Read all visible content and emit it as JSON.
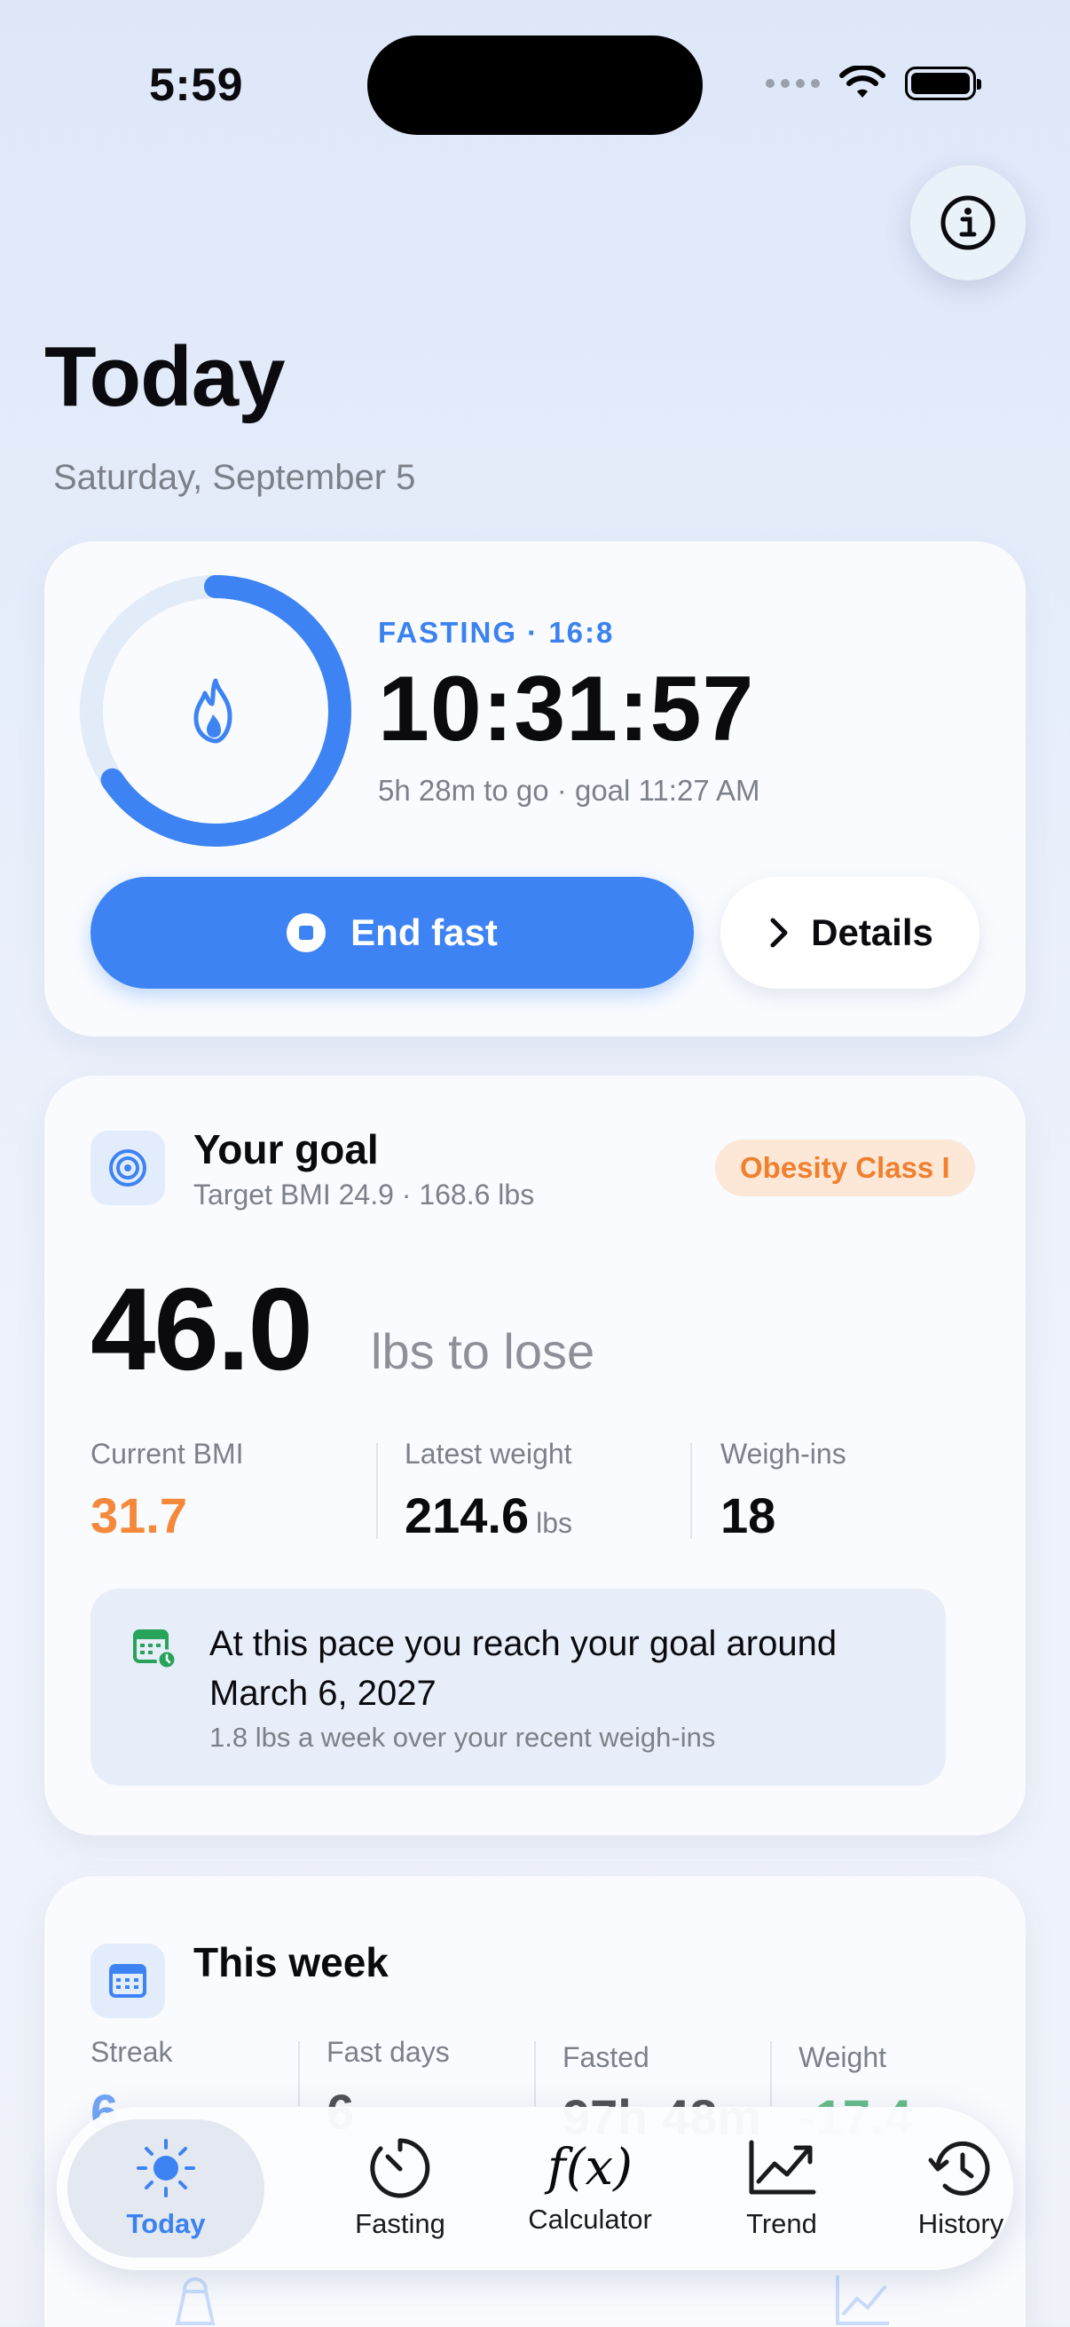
{
  "status_bar": {
    "time": "5:59"
  },
  "header": {
    "title": "Today",
    "date": "Saturday, September 5"
  },
  "fasting_card": {
    "label": "FASTING · 16:8",
    "timer": "10:31:57",
    "subtitle": "5h 28m to go · goal 11:27 AM",
    "progress": 0.656,
    "end_button": "End fast",
    "details_button": "Details",
    "accent": "#3d83f3"
  },
  "goal_card": {
    "title": "Your goal",
    "subtitle": "Target BMI 24.9 · 168.6 lbs",
    "badge": "Obesity Class I",
    "big_value": "46.0",
    "big_unit": "lbs to lose",
    "stats": [
      {
        "label": "Current BMI",
        "value": "31.7",
        "unit": ""
      },
      {
        "label": "Latest weight",
        "value": "214.6",
        "unit": "lbs"
      },
      {
        "label": "Weigh-ins",
        "value": "18",
        "unit": ""
      }
    ],
    "pace_text": "At this pace you reach your goal around March 6, 2027",
    "pace_sub": "1.8 lbs a week over your recent weigh-ins"
  },
  "week_card": {
    "title": "This week",
    "stats": [
      {
        "label": "Streak",
        "value": "6"
      },
      {
        "label": "Fast days",
        "value": "6"
      },
      {
        "label": "Fasted",
        "value": "97h 48m"
      },
      {
        "label": "Weight",
        "value": "-17.4"
      }
    ]
  },
  "tabbar": {
    "tabs": [
      {
        "label": "Today",
        "icon": "sun-icon",
        "active": true
      },
      {
        "label": "Fasting",
        "icon": "timer-icon"
      },
      {
        "label": "Calculator",
        "icon": "function-icon",
        "glyph": "f(x)"
      },
      {
        "label": "Trend",
        "icon": "chart-line-icon"
      },
      {
        "label": "History",
        "icon": "history-icon"
      }
    ]
  }
}
